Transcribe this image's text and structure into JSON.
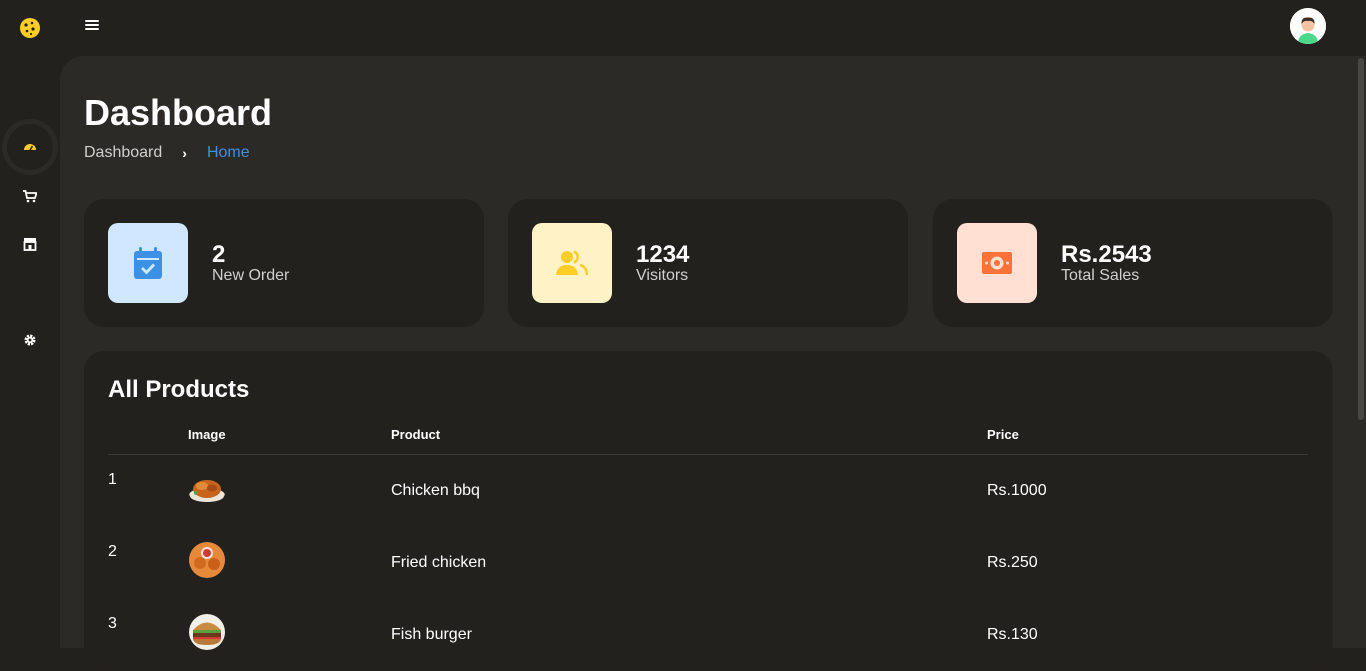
{
  "topbar": {
    "logo_icon": "cookie-icon",
    "menu_icon": "hamburger-menu-icon",
    "avatar_icon": "user-avatar-icon"
  },
  "sidebar": {
    "items": [
      {
        "icon": "dashboard-gauge-icon",
        "active": true
      },
      {
        "icon": "cart-icon",
        "active": false
      },
      {
        "icon": "store-icon",
        "active": false
      },
      {
        "icon": "gear-icon",
        "active": false
      }
    ]
  },
  "page": {
    "title": "Dashboard",
    "breadcrumb": [
      "Dashboard",
      "Home"
    ]
  },
  "stats": [
    {
      "value": "2",
      "label": "New Order",
      "icon": "calendar-check-icon",
      "bg": "#cfe8ff",
      "fg": "#3c91e6"
    },
    {
      "value": "1234",
      "label": "Visitors",
      "icon": "users-icon",
      "bg": "#fff2c6",
      "fg": "#ffce26"
    },
    {
      "value": "Rs.2543",
      "label": "Total Sales",
      "icon": "dollar-banknote-icon",
      "bg": "#ffe0d3",
      "fg": "#fd7238"
    }
  ],
  "products": {
    "title": "All Products",
    "columns": [
      "",
      "Image",
      "Product",
      "Price"
    ],
    "rows": [
      {
        "index": "1",
        "image": "chicken-bbq-image",
        "name": "Chicken bbq",
        "price": "Rs.1000"
      },
      {
        "index": "2",
        "image": "fried-chicken-image",
        "name": "Fried chicken",
        "price": "Rs.250"
      },
      {
        "index": "3",
        "image": "fish-burger-image",
        "name": "Fish burger",
        "price": "Rs.130"
      }
    ]
  },
  "colors": {
    "background": "#23211e",
    "content": "#2c2a27",
    "accent_blue": "#3c91e6",
    "accent_yellow": "#ffce26",
    "accent_orange": "#fd7238"
  }
}
